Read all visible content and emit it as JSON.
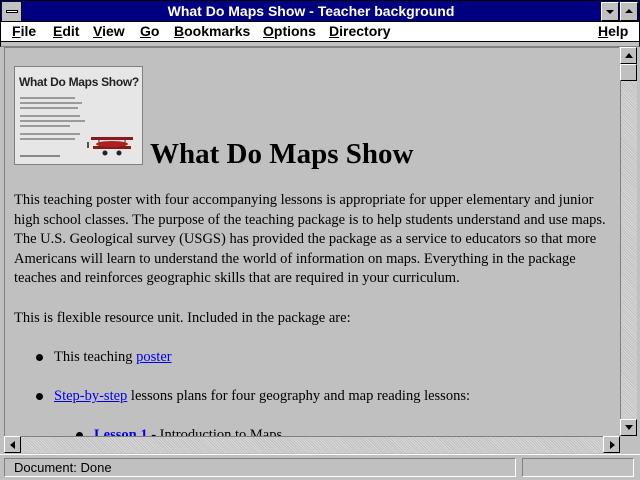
{
  "window": {
    "title": "What Do Maps Show - Teacher background"
  },
  "menu": {
    "items": [
      {
        "label": "File",
        "key": "F",
        "rest": "ile"
      },
      {
        "label": "Edit",
        "key": "E",
        "rest": "dit"
      },
      {
        "label": "View",
        "key": "V",
        "rest": "iew"
      },
      {
        "label": "Go",
        "key": "G",
        "rest": "o"
      },
      {
        "label": "Bookmarks",
        "key": "B",
        "rest": "ookmarks"
      },
      {
        "label": "Options",
        "key": "O",
        "rest": "ptions"
      },
      {
        "label": "Directory",
        "key": "D",
        "rest": "irectory"
      },
      {
        "label": "Help",
        "key": "H",
        "rest": "elp"
      }
    ]
  },
  "page": {
    "poster_thumb_title": "What Do Maps Show?",
    "heading": "What Do Maps Show",
    "intro": "This teaching poster with four accompanying lessons is appropriate for upper elementary and junior high school classes. The purpose of the teaching package is to help students understand and use maps. The U.S. Geological survey (USGS) has provided the package as a service to educators so that more Americans will learn to understand the world of information on maps. Everything in the package teaches and reinforces geographic skills that are required in your curriculum.",
    "resource_intro": "This is flexible resource unit. Included in the package are:",
    "list": {
      "item1_text": "This teaching ",
      "item1_link": "poster",
      "item2_link": "Step-by-step",
      "item2_text": " lessons plans for four geography and map reading lessons:",
      "sub1_link": "Lesson 1",
      "sub1_text": " - Introduction to Maps"
    }
  },
  "status": {
    "text": "Document: Done"
  },
  "colors": {
    "titlebar": "#000080",
    "link": "#0000ee",
    "chrome": "#c0c0c0"
  }
}
